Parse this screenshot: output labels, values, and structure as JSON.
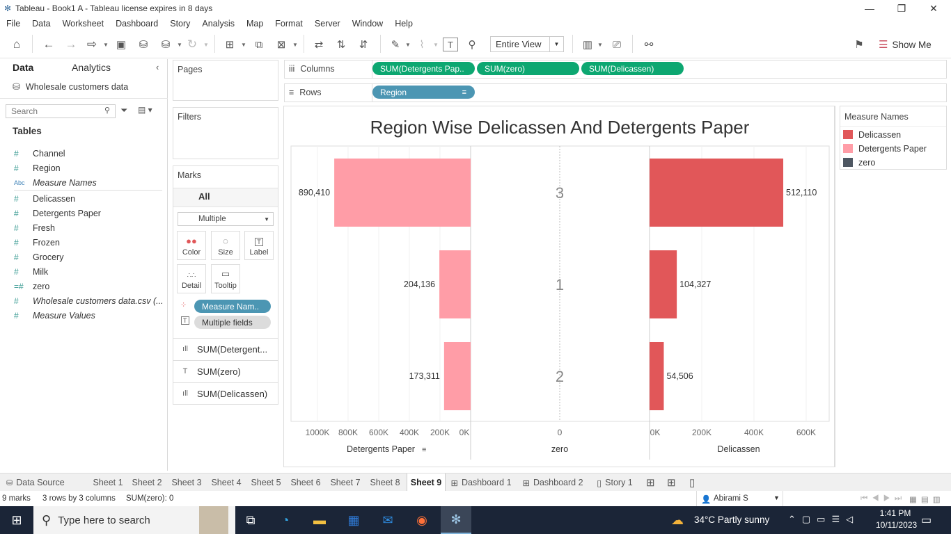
{
  "window": {
    "title": "Tableau - Book1 A - Tableau license expires in 8 days"
  },
  "menu": [
    "File",
    "Data",
    "Worksheet",
    "Dashboard",
    "Story",
    "Analysis",
    "Map",
    "Format",
    "Server",
    "Window",
    "Help"
  ],
  "toolbar": {
    "view_mode": "Entire View",
    "show_me": "Show Me"
  },
  "data_pane": {
    "tabs": {
      "data": "Data",
      "analytics": "Analytics"
    },
    "datasource": "Wholesale customers data",
    "search_placeholder": "Search",
    "tables_heading": "Tables",
    "fields": [
      {
        "type": "#",
        "name": "Channel",
        "italic": false
      },
      {
        "type": "#",
        "name": "Region",
        "italic": false
      },
      {
        "type": "Abc",
        "name": "Measure Names",
        "italic": true
      },
      {
        "type": "#",
        "name": "Delicassen",
        "italic": false
      },
      {
        "type": "#",
        "name": "Detergents Paper",
        "italic": false
      },
      {
        "type": "#",
        "name": "Fresh",
        "italic": false
      },
      {
        "type": "#",
        "name": "Frozen",
        "italic": false
      },
      {
        "type": "#",
        "name": "Grocery",
        "italic": false
      },
      {
        "type": "#",
        "name": "Milk",
        "italic": false
      },
      {
        "type": "=#",
        "name": "zero",
        "italic": false
      },
      {
        "type": "#",
        "name": "Wholesale customers data.csv (...",
        "italic": true
      },
      {
        "type": "#",
        "name": "Measure Values",
        "italic": true
      }
    ]
  },
  "cards": {
    "pages": "Pages",
    "filters": "Filters",
    "marks": "Marks",
    "all": "All",
    "mark_type": "Multiple",
    "buttons": {
      "color": "Color",
      "size": "Size",
      "label": "Label",
      "detail": "Detail",
      "tooltip": "Tooltip"
    },
    "pills": {
      "measure_names": "Measure Nam..",
      "multiple_fields": "Multiple fields"
    },
    "measures": [
      "SUM(Detergent...",
      "SUM(zero)",
      "SUM(Delicassen)"
    ]
  },
  "shelves": {
    "columns_label": "Columns",
    "rows_label": "Rows",
    "columns": [
      "SUM(Detergents Pap..",
      "SUM(zero)",
      "SUM(Delicassen)"
    ],
    "rows": [
      "Region"
    ]
  },
  "legend": {
    "title": "Measure Names",
    "items": [
      {
        "name": "Delicassen",
        "color": "#e15759"
      },
      {
        "name": "Detergents Paper",
        "color": "#ff9da7"
      },
      {
        "name": "zero",
        "color": "#4e5762"
      }
    ]
  },
  "chart_data": {
    "type": "bar",
    "title": "Region Wise Delicassen And Detergents Paper",
    "categories": [
      "3",
      "1",
      "2"
    ],
    "series": [
      {
        "name": "Detergents Paper",
        "values": [
          890410,
          204136,
          173311
        ],
        "labels": [
          "890,410",
          "204,136",
          "173,311"
        ],
        "color": "#ff9da7",
        "reversed": true,
        "ticks": [
          "1000K",
          "800K",
          "600K",
          "400K",
          "200K",
          "0K"
        ],
        "xlim": [
          0,
          1000000
        ]
      },
      {
        "name": "zero",
        "values": [
          0,
          0,
          0
        ],
        "labels": [
          "3",
          "1",
          "2"
        ],
        "ticks": [
          "0"
        ]
      },
      {
        "name": "Delicassen",
        "values": [
          512110,
          104327,
          54506
        ],
        "labels": [
          "512,110",
          "104,327",
          "54,506"
        ],
        "color": "#e15759",
        "reversed": false,
        "ticks": [
          "0K",
          "200K",
          "400K",
          "600K"
        ],
        "xlim": [
          0,
          600000
        ]
      }
    ],
    "axis_labels": [
      "Detergents Paper",
      "zero",
      "Delicassen"
    ],
    "grid": true
  },
  "sheet_tabs": {
    "datasource": "Data Source",
    "sheets": [
      "Sheet 1",
      "Sheet 2",
      "Sheet 3",
      "Sheet 4",
      "Sheet 5",
      "Sheet 6",
      "Sheet 7",
      "Sheet 8",
      "Sheet 9",
      "Dashboard 1",
      "Dashboard 2",
      "Story 1"
    ],
    "active": "Sheet 9"
  },
  "status": {
    "marks": "9 marks",
    "dims": "3 rows by 3 columns",
    "sum": "SUM(zero): 0",
    "user": "Abirami S"
  },
  "taskbar": {
    "search_placeholder": "Type here to search",
    "weather": "34°C  Partly sunny",
    "time": "1:41 PM",
    "date": "10/11/2023"
  }
}
